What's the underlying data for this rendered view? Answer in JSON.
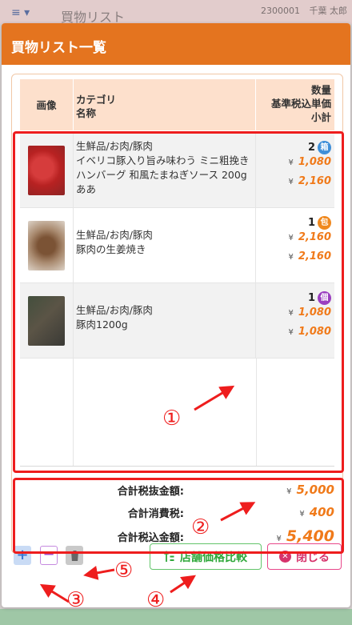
{
  "background": {
    "menu_icon": "≡ ▾",
    "title": "買物リスト",
    "user_code": "2300001",
    "user_name": "千葉 太郎"
  },
  "modal": {
    "title": "買物リスト一覧",
    "header_color": "#e4741f",
    "table": {
      "headers": {
        "image": "画像",
        "category_line1": "カテゴリ",
        "category_line2": "名称",
        "qty_line1": "数量",
        "qty_line2": "基準税込単価",
        "qty_line3": "小計"
      },
      "rows": [
        {
          "image": "meat-photo",
          "category": "生鮮品/お肉/豚肉",
          "name": "イベリコ豚入り旨み味わう ミニ粗挽きハンバーグ 和風たまねぎソース 200gああ",
          "qty": "2",
          "unit": "箱",
          "unit_color": "#3f8fd8",
          "yen": "¥",
          "unit_price": "1,080",
          "subtotal": "2,160"
        },
        {
          "image": "ginger-pork-photo",
          "category": "生鮮品/お肉/豚肉",
          "name": "豚肉の生姜焼き",
          "qty": "1",
          "unit": "包",
          "unit_color": "#f0891f",
          "yen": "¥",
          "unit_price": "2,160",
          "subtotal": "2,160"
        },
        {
          "image": "pork-photo",
          "category": "生鮮品/お肉/豚肉",
          "name": "豚肉1200g",
          "qty": "1",
          "unit": "個",
          "unit_color": "#9b3fc0",
          "yen": "¥",
          "unit_price": "1,080",
          "subtotal": "1,080"
        }
      ]
    },
    "totals": {
      "excl_tax_label": "合計税抜金額:",
      "excl_tax_value": "5,000",
      "tax_label": "合計消費税:",
      "tax_value": "400",
      "incl_tax_label": "合計税込金額:",
      "incl_tax_value": "5,400",
      "yen": "¥"
    },
    "buttons": {
      "add": "+",
      "minus": "−",
      "compare": "店舗価格比較",
      "close": "閉じる"
    }
  },
  "annotations": {
    "n1": "①",
    "n2": "②",
    "n3": "③",
    "n4": "④",
    "n5": "⑤",
    "color": "#ee1d1d"
  }
}
